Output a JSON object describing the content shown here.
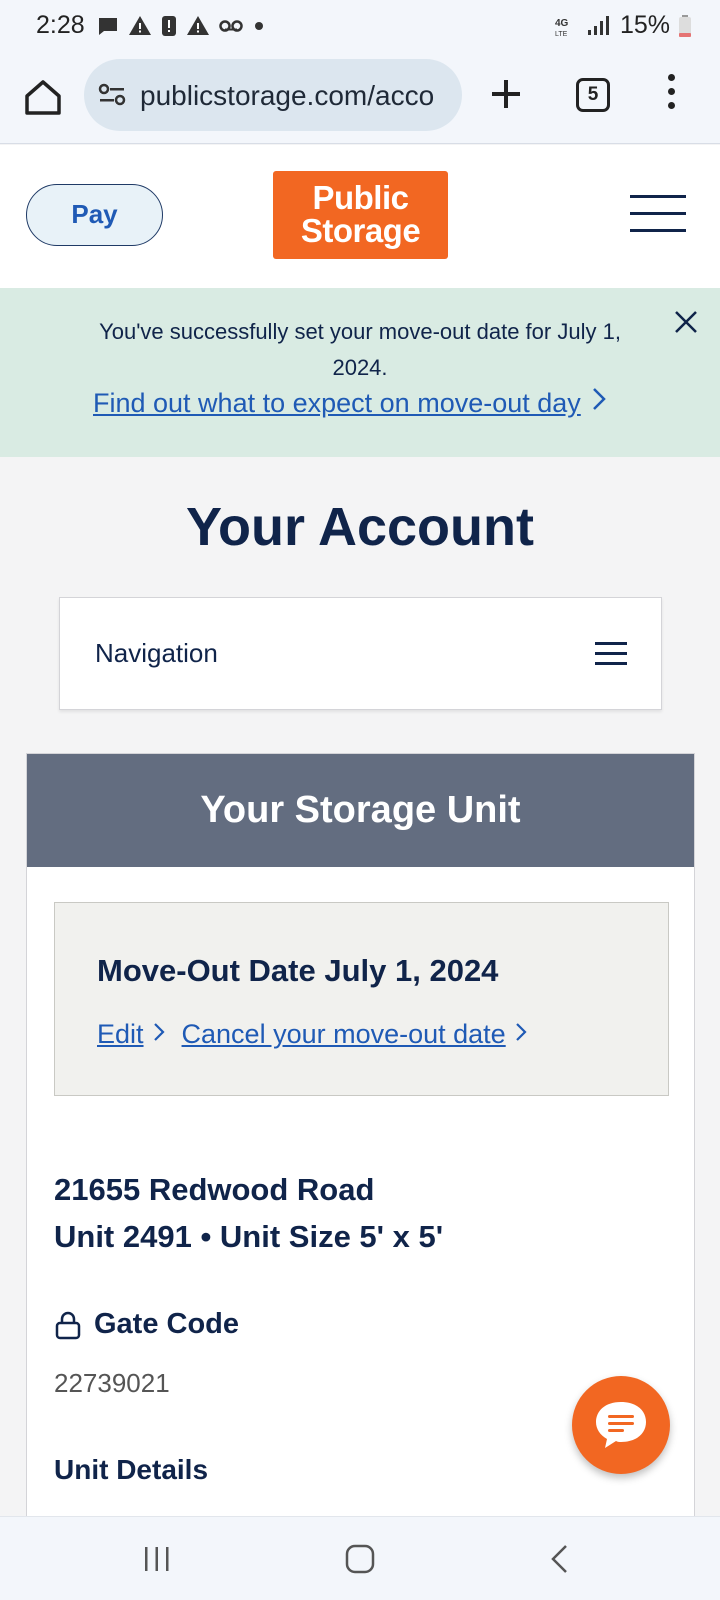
{
  "status_bar": {
    "time": "2:28",
    "battery": "15%",
    "network": "4G LTE"
  },
  "browser": {
    "url": "publicstorage.com/acco",
    "tab_count": "5"
  },
  "header": {
    "pay_label": "Pay",
    "logo_line1": "Public",
    "logo_line2": "Storage"
  },
  "banner": {
    "message": "You've successfully set your move-out date for July 1, 2024.",
    "link": "Find out what to expect on move-out day"
  },
  "page": {
    "title": "Your Account"
  },
  "navigation": {
    "label": "Navigation"
  },
  "unit": {
    "header": "Your Storage Unit",
    "moveout_title": "Move-Out Date July 1, 2024",
    "edit_label": "Edit",
    "cancel_label": "Cancel your move-out date",
    "address_line": "21655 Redwood Road",
    "unit_line": "Unit 2491 • Unit Size 5' x 5'",
    "gate_label": "Gate Code",
    "gate_code": "22739021",
    "details_label": "Unit Details"
  },
  "colors": {
    "brand_orange": "#f26722",
    "navy": "#10244a",
    "link_blue": "#1f5ab5",
    "banner_green": "#d9ebe3",
    "unit_header_gray": "#636d80"
  }
}
